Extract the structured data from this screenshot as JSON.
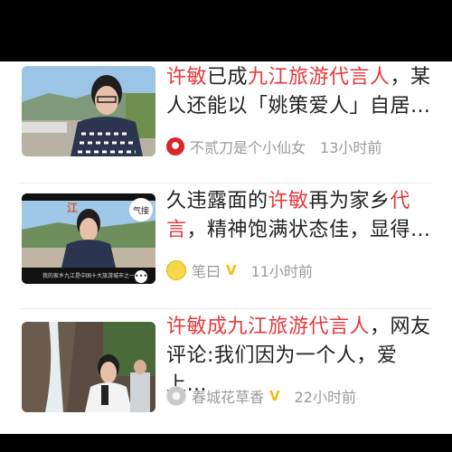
{
  "articles": [
    {
      "headline_red": "许敏",
      "headline_rest_1": "已成",
      "headline_red_2": "九江旅游代言人",
      "headline_rest_2": "，某人还能以「姚策爱人」自居…",
      "author": "不贰刀是个小仙女",
      "time": "13小时前",
      "avatar_icon": "red-circle-icon",
      "verified": false
    },
    {
      "headline_pre": "久违露面的",
      "headline_red": "许敏",
      "headline_mid": "再为家乡",
      "headline_red_2": "代言",
      "headline_rest": "，精神饱满状态佳，显得…",
      "author": "笔曰",
      "badge": "V",
      "time": "11小时前",
      "avatar_icon": "lightbulb-icon",
      "thumb_caption": "我的家乡九江是中国十大旅游城市之一",
      "thumb_corner": "江"
    },
    {
      "headline_red": "许敏成九江旅游代言人",
      "headline_rest": "，网友评论:我们因为一个人，爱上…",
      "author": "春城花草香",
      "badge": "V",
      "time": "22小时前",
      "avatar_icon": "flower-avatar-icon"
    }
  ],
  "colors": {
    "highlight": "#e4393c",
    "meta": "#9a9a9a",
    "badge": "#f0c010"
  }
}
